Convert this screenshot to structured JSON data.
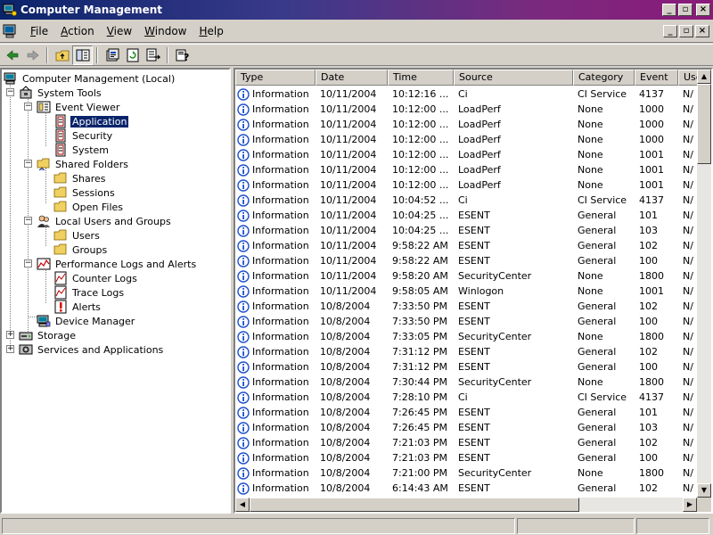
{
  "window": {
    "title": "Computer Management"
  },
  "menubar": {
    "items": [
      {
        "key": "F",
        "rest": "ile"
      },
      {
        "key": "A",
        "rest": "ction"
      },
      {
        "key": "V",
        "rest": "iew"
      },
      {
        "key": "W",
        "rest": "indow"
      },
      {
        "key": "H",
        "rest": "elp"
      }
    ]
  },
  "tree": {
    "items": [
      {
        "label": "Computer Management (Local)",
        "icon": "computer-icon"
      },
      {
        "label": "System Tools",
        "icon": "system-tools-icon"
      },
      {
        "label": "Event Viewer",
        "icon": "event-viewer-icon"
      },
      {
        "label": "Application",
        "icon": "event-log-icon"
      },
      {
        "label": "Security",
        "icon": "event-log-icon"
      },
      {
        "label": "System",
        "icon": "event-log-icon"
      },
      {
        "label": "Shared Folders",
        "icon": "shared-folder-icon"
      },
      {
        "label": "Shares",
        "icon": "folder-icon"
      },
      {
        "label": "Sessions",
        "icon": "folder-icon"
      },
      {
        "label": "Open Files",
        "icon": "folder-icon"
      },
      {
        "label": "Local Users and Groups",
        "icon": "users-icon"
      },
      {
        "label": "Users",
        "icon": "folder-icon"
      },
      {
        "label": "Groups",
        "icon": "folder-icon"
      },
      {
        "label": "Performance Logs and Alerts",
        "icon": "performance-icon"
      },
      {
        "label": "Counter Logs",
        "icon": "chart-log-icon"
      },
      {
        "label": "Trace Logs",
        "icon": "chart-log-icon"
      },
      {
        "label": "Alerts",
        "icon": "alert-icon"
      },
      {
        "label": "Device Manager",
        "icon": "device-manager-icon"
      },
      {
        "label": "Storage",
        "icon": "storage-icon"
      },
      {
        "label": "Services and Applications",
        "icon": "services-icon"
      }
    ]
  },
  "list": {
    "columns": [
      "Type",
      "Date",
      "Time",
      "Source",
      "Category",
      "Event",
      "Use"
    ],
    "rows": [
      [
        "Information",
        "10/11/2004",
        "10:12:16 ...",
        "Ci",
        "CI Service",
        "4137",
        "N/A"
      ],
      [
        "Information",
        "10/11/2004",
        "10:12:00 ...",
        "LoadPerf",
        "None",
        "1000",
        "N/A"
      ],
      [
        "Information",
        "10/11/2004",
        "10:12:00 ...",
        "LoadPerf",
        "None",
        "1000",
        "N/A"
      ],
      [
        "Information",
        "10/11/2004",
        "10:12:00 ...",
        "LoadPerf",
        "None",
        "1000",
        "N/A"
      ],
      [
        "Information",
        "10/11/2004",
        "10:12:00 ...",
        "LoadPerf",
        "None",
        "1001",
        "N/A"
      ],
      [
        "Information",
        "10/11/2004",
        "10:12:00 ...",
        "LoadPerf",
        "None",
        "1001",
        "N/A"
      ],
      [
        "Information",
        "10/11/2004",
        "10:12:00 ...",
        "LoadPerf",
        "None",
        "1001",
        "N/A"
      ],
      [
        "Information",
        "10/11/2004",
        "10:04:52 ...",
        "Ci",
        "CI Service",
        "4137",
        "N/A"
      ],
      [
        "Information",
        "10/11/2004",
        "10:04:25 ...",
        "ESENT",
        "General",
        "101",
        "N/A"
      ],
      [
        "Information",
        "10/11/2004",
        "10:04:25 ...",
        "ESENT",
        "General",
        "103",
        "N/A"
      ],
      [
        "Information",
        "10/11/2004",
        "9:58:22 AM",
        "ESENT",
        "General",
        "102",
        "N/A"
      ],
      [
        "Information",
        "10/11/2004",
        "9:58:22 AM",
        "ESENT",
        "General",
        "100",
        "N/A"
      ],
      [
        "Information",
        "10/11/2004",
        "9:58:20 AM",
        "SecurityCenter",
        "None",
        "1800",
        "N/A"
      ],
      [
        "Information",
        "10/11/2004",
        "9:58:05 AM",
        "Winlogon",
        "None",
        "1001",
        "N/A"
      ],
      [
        "Information",
        "10/8/2004",
        "7:33:50 PM",
        "ESENT",
        "General",
        "102",
        "N/A"
      ],
      [
        "Information",
        "10/8/2004",
        "7:33:50 PM",
        "ESENT",
        "General",
        "100",
        "N/A"
      ],
      [
        "Information",
        "10/8/2004",
        "7:33:05 PM",
        "SecurityCenter",
        "None",
        "1800",
        "N/A"
      ],
      [
        "Information",
        "10/8/2004",
        "7:31:12 PM",
        "ESENT",
        "General",
        "102",
        "N/A"
      ],
      [
        "Information",
        "10/8/2004",
        "7:31:12 PM",
        "ESENT",
        "General",
        "100",
        "N/A"
      ],
      [
        "Information",
        "10/8/2004",
        "7:30:44 PM",
        "SecurityCenter",
        "None",
        "1800",
        "N/A"
      ],
      [
        "Information",
        "10/8/2004",
        "7:28:10 PM",
        "Ci",
        "CI Service",
        "4137",
        "N/A"
      ],
      [
        "Information",
        "10/8/2004",
        "7:26:45 PM",
        "ESENT",
        "General",
        "101",
        "N/A"
      ],
      [
        "Information",
        "10/8/2004",
        "7:26:45 PM",
        "ESENT",
        "General",
        "103",
        "N/A"
      ],
      [
        "Information",
        "10/8/2004",
        "7:21:03 PM",
        "ESENT",
        "General",
        "102",
        "N/A"
      ],
      [
        "Information",
        "10/8/2004",
        "7:21:03 PM",
        "ESENT",
        "General",
        "100",
        "N/A"
      ],
      [
        "Information",
        "10/8/2004",
        "7:21:00 PM",
        "SecurityCenter",
        "None",
        "1800",
        "N/A"
      ],
      [
        "Information",
        "10/8/2004",
        "6:14:43 AM",
        "ESENT",
        "General",
        "102",
        "N/A"
      ]
    ]
  },
  "colors": {
    "title_start": "#0a246a",
    "title_end": "#8a1a7a",
    "face": "#d4d0c8",
    "selection": "#0a246a",
    "info_icon": "#1c4fd0"
  }
}
